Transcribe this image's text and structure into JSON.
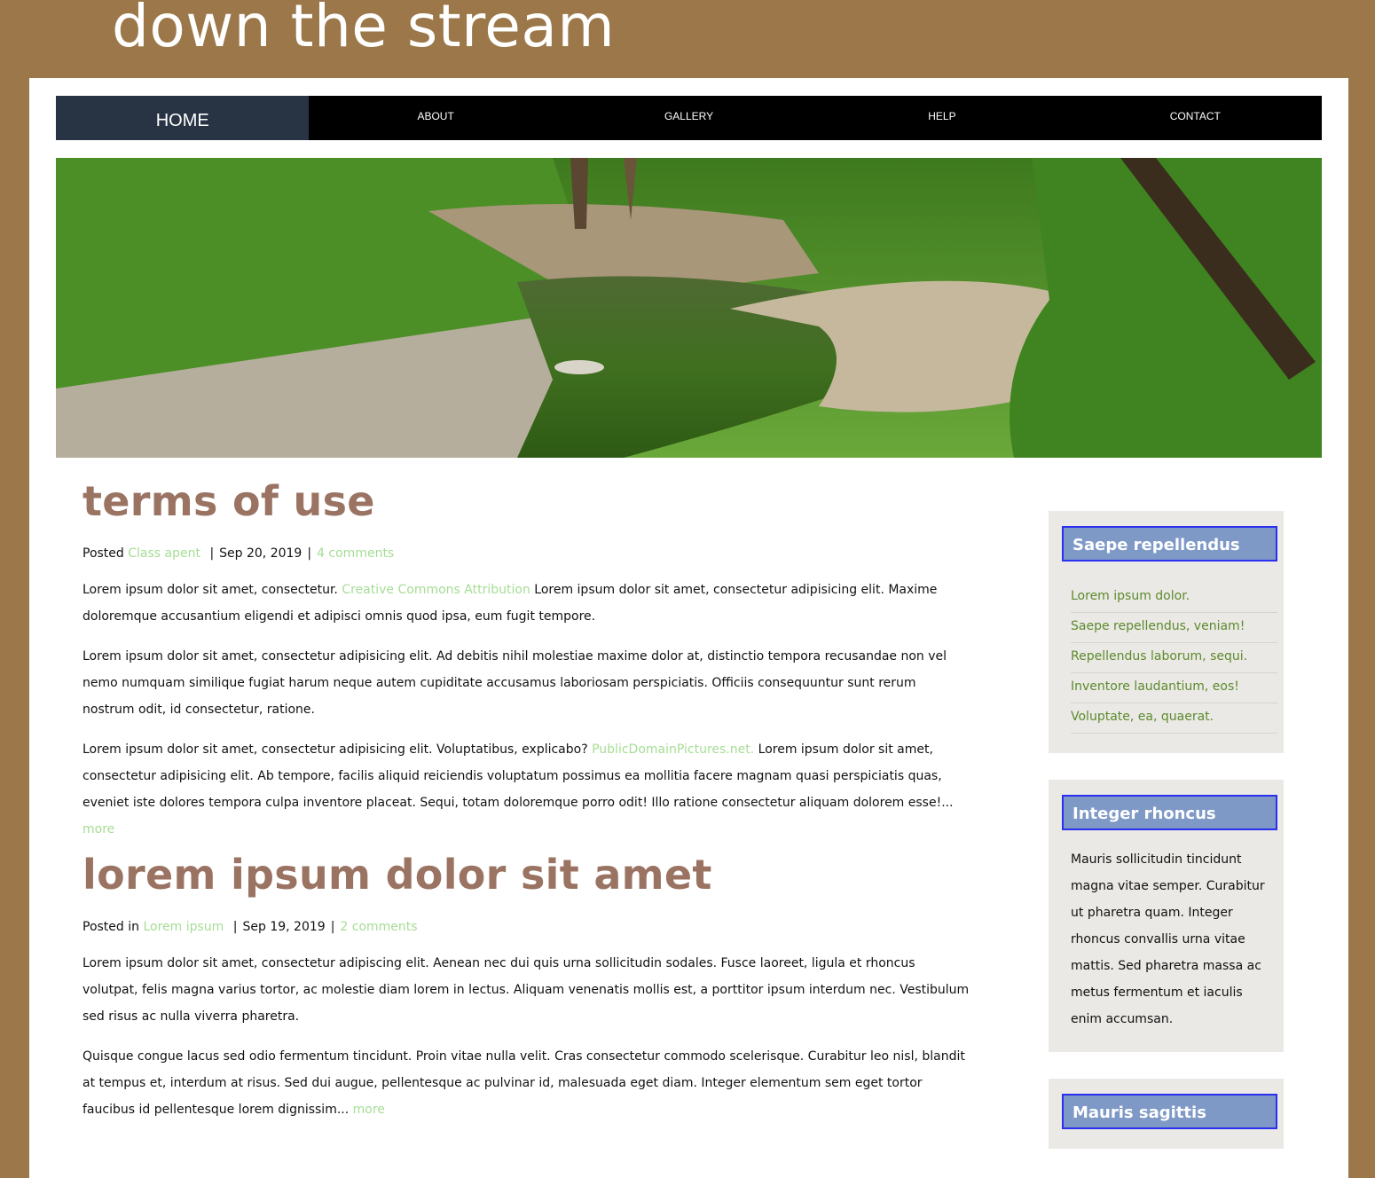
{
  "site": {
    "title": "down the stream"
  },
  "nav": {
    "items": [
      {
        "label": "HOME"
      },
      {
        "label": "ABOUT"
      },
      {
        "label": "GALLERY"
      },
      {
        "label": "HELP"
      },
      {
        "label": "CONTACT"
      }
    ]
  },
  "posts": [
    {
      "title": "terms of use",
      "meta_prefix": "Posted",
      "author": "Class apent",
      "date": "Sep 20, 2019",
      "comments": "4 comments",
      "paragraphs": [
        {
          "pre": "Lorem ipsum dolor sit amet, consectetur. ",
          "link": "Creative Commons Attribution",
          "post": " Lorem ipsum dolor sit amet, consectetur adipisicing elit. Maxime doloremque accusantium eligendi et adipisci omnis quod ipsa, eum fugit tempore."
        },
        {
          "pre": "Lorem ipsum dolor sit amet, consectetur adipisicing elit. Ad debitis nihil molestiae maxime dolor at, distinctio tempora recusandae non vel nemo numquam similique fugiat harum neque autem cupiditate accusamus laboriosam perspiciatis. Officiis consequuntur sunt rerum nostrum odit, id consectetur, ratione.",
          "link": "",
          "post": ""
        },
        {
          "pre": "Lorem ipsum dolor sit amet, consectetur adipisicing elit. Voluptatibus, explicabo? ",
          "link": "PublicDomainPictures.net.",
          "post": " Lorem ipsum dolor sit amet, consectetur adipisicing elit. Ab tempore, facilis aliquid reiciendis voluptatum possimus ea mollitia facere magnam quasi perspiciatis quas, eveniet iste dolores tempora culpa inventore placeat. Sequi, totam doloremque porro odit! Illo ratione consectetur aliquam dolorem esse!... ",
          "more": "more"
        }
      ]
    },
    {
      "title": "lorem ipsum dolor sit amet",
      "meta_prefix": "Posted in",
      "author": "Lorem ipsum",
      "date": "Sep 19, 2019",
      "comments": "2 comments",
      "paragraphs": [
        {
          "pre": "Lorem ipsum dolor sit amet, consectetur adipiscing elit. Aenean nec dui quis urna sollicitudin sodales. Fusce laoreet, ligula et rhoncus volutpat, felis magna varius tortor, ac molestie diam lorem in lectus. Aliquam venenatis mollis est, a porttitor ipsum interdum nec. Vestibulum sed risus ac nulla viverra pharetra.",
          "link": "",
          "post": ""
        },
        {
          "pre": "Quisque congue lacus sed odio fermentum tincidunt. Proin vitae nulla velit. Cras consectetur commodo scelerisque. Curabitur leo nisl, blandit at tempus et, interdum at risus. Sed dui augue, pellentesque ac pulvinar id, malesuada eget diam. Integer elementum sem eget tortor faucibus id pellentesque lorem dignissim... ",
          "link": "",
          "post": "",
          "more": "more"
        }
      ]
    }
  ],
  "sidebar": {
    "widget1": {
      "title": "Saepe repellendus",
      "items": [
        "Lorem ipsum dolor.",
        "Saepe repellendus, veniam!",
        "Repellendus laborum, sequi.",
        "Inventore laudantium, eos!",
        "Voluptate, ea, quaerat."
      ]
    },
    "widget2": {
      "title": "Integer rhoncus",
      "text": "Mauris sollicitudin tincidunt magna vitae semper. Curabitur ut pharetra quam. Integer rhoncus convallis urna vitae mattis. Sed pharetra massa ac metus fermentum et iaculis enim accumsan."
    },
    "widget3": {
      "title": "Mauris sagittis"
    }
  },
  "colors": {
    "background": "#9b774a",
    "nav_active": "#283444",
    "post_title": "#9a7362",
    "link": "#a6dd95",
    "widget_title_bg": "#7e99c6",
    "widget_title_border": "#2b2ff0",
    "sidebar_bg": "#ebe9e5"
  }
}
